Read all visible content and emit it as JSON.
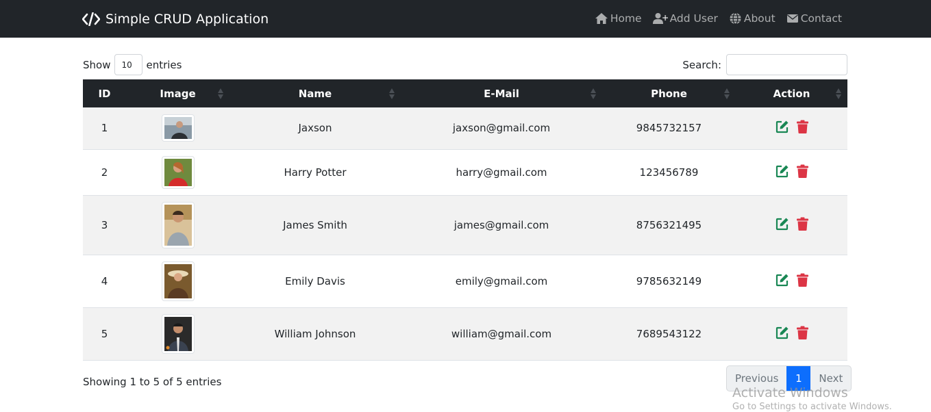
{
  "navbar": {
    "brand": "Simple CRUD Application",
    "links": [
      {
        "label": "Home",
        "icon": "home-icon"
      },
      {
        "label": "Add User",
        "icon": "user-plus-icon"
      },
      {
        "label": "About",
        "icon": "globe-icon"
      },
      {
        "label": "Contact",
        "icon": "envelope-icon"
      }
    ]
  },
  "table_controls": {
    "show_label": "Show",
    "entries_value": "10",
    "entries_label": "entries",
    "search_label": "Search:",
    "search_value": ""
  },
  "table": {
    "columns": [
      "ID",
      "Image",
      "Name",
      "E-Mail",
      "Phone",
      "Action"
    ],
    "rows": [
      {
        "id": "1",
        "name": "Jaxson",
        "email": "jaxson@gmail.com",
        "phone": "9845732157"
      },
      {
        "id": "2",
        "name": "Harry Potter",
        "email": "harry@gmail.com",
        "phone": "123456789"
      },
      {
        "id": "3",
        "name": "James Smith",
        "email": "james@gmail.com",
        "phone": "8756321495"
      },
      {
        "id": "4",
        "name": "Emily Davis",
        "email": "emily@gmail.com",
        "phone": "9785632149"
      },
      {
        "id": "5",
        "name": "William Johnson",
        "email": "william@gmail.com",
        "phone": "7689543122"
      }
    ]
  },
  "footer": {
    "info": "Showing 1 to 5 of 5 entries",
    "pagination": {
      "previous": "Previous",
      "current": "1",
      "next": "Next"
    }
  },
  "watermark": {
    "line1": "Activate Windows",
    "line2": "Go to Settings to activate Windows."
  },
  "colors": {
    "navbar_bg": "#212529",
    "edit": "#198754",
    "delete": "#dc3545",
    "active_page": "#0d6efd"
  }
}
